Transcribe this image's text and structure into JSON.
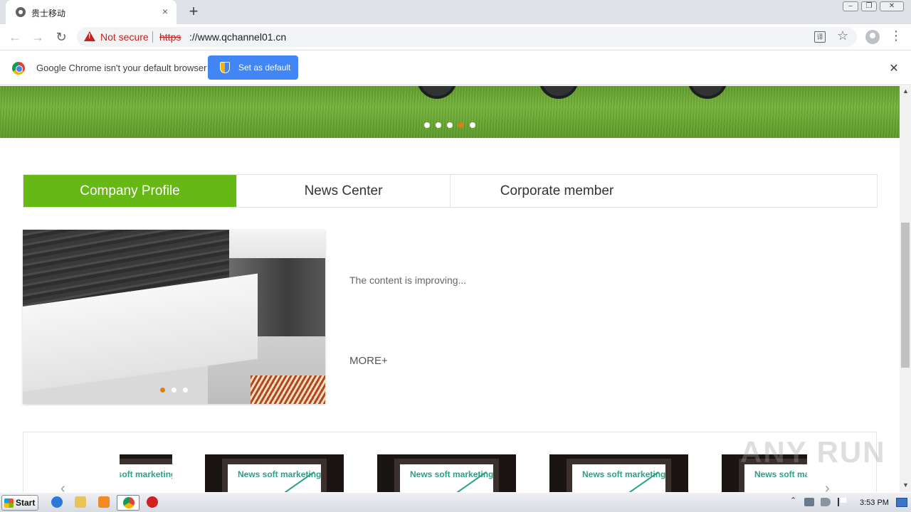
{
  "browser": {
    "tab_title": "贵士移动",
    "tab_close": "×",
    "new_tab": "+",
    "window_buttons": {
      "minimize": "–",
      "restore": "❐",
      "close": "✕"
    },
    "nav": {
      "back": "←",
      "forward": "→",
      "reload": "↻"
    },
    "security_label": "Not secure",
    "url_scheme": "https",
    "url_rest": "://www.qchannel01.cn",
    "translate_glyph": "译",
    "bookmark_glyph": "☆",
    "menu_glyph": "⋮"
  },
  "infobar": {
    "message": "Google Chrome isn't your default browser",
    "button_label": "Set as default",
    "close_glyph": "✕"
  },
  "banner": {
    "dots": 5,
    "active_dot": 4
  },
  "tabs": [
    {
      "label": "Company Profile",
      "active": true
    },
    {
      "label": "News Center",
      "active": false
    },
    {
      "label": "Corporate member",
      "active": false
    }
  ],
  "profile": {
    "text": "The content is improving...",
    "more": "MORE+",
    "slider_dots": 3,
    "active_dot": 1
  },
  "news": {
    "card_label": "News soft marketing",
    "prev_glyph": "‹",
    "next_glyph": "›"
  },
  "scrollbar": {
    "up": "▲",
    "down": "▼"
  },
  "watermark": "ANY RUN",
  "taskbar": {
    "start_label": "Start",
    "tray_expand": "⌃",
    "time": "3:53 PM"
  },
  "colors": {
    "accent_green": "#66b814",
    "chrome_blue": "#4285f4",
    "warning_red": "#c5221f",
    "dot_orange": "#e07b1a"
  }
}
